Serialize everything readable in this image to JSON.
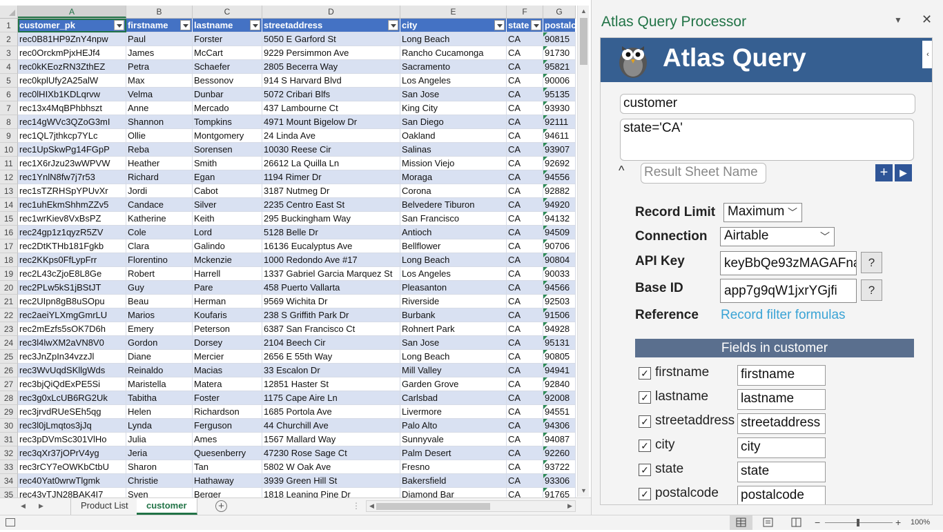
{
  "grid": {
    "columns": [
      {
        "letter": "A",
        "w": 157
      },
      {
        "letter": "B",
        "w": 96
      },
      {
        "letter": "C",
        "w": 101
      },
      {
        "letter": "D",
        "w": 200
      },
      {
        "letter": "E",
        "w": 154
      },
      {
        "letter": "F",
        "w": 53
      },
      {
        "letter": "G",
        "w": 47
      }
    ],
    "headers": [
      "customer_pk",
      "firstname",
      "lastname",
      "streetaddress",
      "city",
      "state",
      "postalco"
    ],
    "rows": [
      [
        "rec0B81HP9ZnY4npw",
        "Paul",
        "Forster",
        "5050 E Garford St",
        "Long Beach",
        "CA",
        "90815"
      ],
      [
        "rec0OrckmPjxHEJf4",
        "James",
        "McCart",
        "9229 Persimmon Ave",
        "Rancho Cucamonga",
        "CA",
        "91730"
      ],
      [
        "rec0kKEozRN3ZthEZ",
        "Petra",
        "Schaefer",
        "2805 Becerra Way",
        "Sacramento",
        "CA",
        "95821"
      ],
      [
        "rec0kplUfy2A25alW",
        "Max",
        "Bessonov",
        "914 S Harvard Blvd",
        "Los Angeles",
        "CA",
        "90006"
      ],
      [
        "rec0lHIXb1KDLqrvw",
        "Velma",
        "Dunbar",
        "5072 Cribari Blfs",
        "San Jose",
        "CA",
        "95135"
      ],
      [
        "rec13x4MqBPhbhszt",
        "Anne",
        "Mercado",
        "437 Lambourne Ct",
        "King City",
        "CA",
        "93930"
      ],
      [
        "rec14gWVc3QZoG3mI",
        "Shannon",
        "Tompkins",
        "4971 Mount Bigelow Dr",
        "San Diego",
        "CA",
        "92111"
      ],
      [
        "rec1QL7jthkcp7YLc",
        "Ollie",
        "Montgomery",
        "24 Linda Ave",
        "Oakland",
        "CA",
        "94611"
      ],
      [
        "rec1UpSkwPg14FGpP",
        "Reba",
        "Sorensen",
        "10030 Reese Cir",
        "Salinas",
        "CA",
        "93907"
      ],
      [
        "rec1X6rJzu23wWPVW",
        "Heather",
        "Smith",
        "26612 La Quilla Ln",
        "Mission Viejo",
        "CA",
        "92692"
      ],
      [
        "rec1YnlN8fw7j7r53",
        "Richard",
        "Egan",
        "1194 Rimer Dr",
        "Moraga",
        "CA",
        "94556"
      ],
      [
        "rec1sTZRHSpYPUvXr",
        "Jordi",
        "Cabot",
        "3187 Nutmeg Dr",
        "Corona",
        "CA",
        "92882"
      ],
      [
        "rec1uhEkmShhmZZv5",
        "Candace",
        "Silver",
        "2235 Centro East St",
        "Belvedere Tiburon",
        "CA",
        "94920"
      ],
      [
        "rec1wrKiev8VxBsPZ",
        "Katherine",
        "Keith",
        "295 Buckingham Way",
        "San Francisco",
        "CA",
        "94132"
      ],
      [
        "rec24gp1z1qyzR5ZV",
        "Cole",
        "Lord",
        "5128 Belle Dr",
        "Antioch",
        "CA",
        "94509"
      ],
      [
        "rec2DtKTHb181Fgkb",
        "Clara",
        "Galindo",
        "16136 Eucalyptus Ave",
        "Bellflower",
        "CA",
        "90706"
      ],
      [
        "rec2KKps0FfLypFrr",
        "Florentino",
        "Mckenzie",
        "1000 Redondo Ave #17",
        "Long Beach",
        "CA",
        "90804"
      ],
      [
        "rec2L43cZjoE8L8Ge",
        "Robert",
        "Harrell",
        "1337 Gabriel Garcia Marquez St",
        "Los Angeles",
        "CA",
        "90033"
      ],
      [
        "rec2PLw5kS1jBStJT",
        "Guy",
        "Pare",
        "458 Puerto Vallarta",
        "Pleasanton",
        "CA",
        "94566"
      ],
      [
        "rec2UIpn8gB8uSOpu",
        "Beau",
        "Herman",
        "9569 Wichita Dr",
        "Riverside",
        "CA",
        "92503"
      ],
      [
        "rec2aeiYLXmgGmrLU",
        "Marios",
        "Koufaris",
        "238 S Griffith Park Dr",
        "Burbank",
        "CA",
        "91506"
      ],
      [
        "rec2mEzfs5sOK7D6h",
        "Emery",
        "Peterson",
        "6387 San Francisco Ct",
        "Rohnert Park",
        "CA",
        "94928"
      ],
      [
        "rec3l4lwXM2aVN8V0",
        "Gordon",
        "Dorsey",
        "2104 Beech Cir",
        "San Jose",
        "CA",
        "95131"
      ],
      [
        "rec3JnZpIn34vzzJl",
        "Diane",
        "Mercier",
        "2656 E 55th Way",
        "Long Beach",
        "CA",
        "90805"
      ],
      [
        "rec3WvUqdSKllgWds",
        "Reinaldo",
        "Macias",
        "33 Escalon Dr",
        "Mill Valley",
        "CA",
        "94941"
      ],
      [
        "rec3bjQiQdExPE5Si",
        "Maristella",
        "Matera",
        "12851 Haster St",
        "Garden Grove",
        "CA",
        "92840"
      ],
      [
        "rec3g0xLcUB6RG2Uk",
        "Tabitha",
        "Foster",
        "1175 Cape Aire Ln",
        "Carlsbad",
        "CA",
        "92008"
      ],
      [
        "rec3jrvdRUeSEh5qg",
        "Helen",
        "Richardson",
        "1685 Portola Ave",
        "Livermore",
        "CA",
        "94551"
      ],
      [
        "rec3l0jLmqtos3jJq",
        "Lynda",
        "Ferguson",
        "44 Churchill Ave",
        "Palo Alto",
        "CA",
        "94306"
      ],
      [
        "rec3pDVmSc301VlHo",
        "Julia",
        "Ames",
        "1567 Mallard Way",
        "Sunnyvale",
        "CA",
        "94087"
      ],
      [
        "rec3qXr37jOPrV4yg",
        "Jeria",
        "Quesenberry",
        "47230 Rose Sage Ct",
        "Palm Desert",
        "CA",
        "92260"
      ],
      [
        "rec3rCY7eOWKbCtbU",
        "Sharon",
        "Tan",
        "5802 W Oak Ave",
        "Fresno",
        "CA",
        "93722"
      ],
      [
        "rec40Yat0wrwTlgmk",
        "Christie",
        "Hathaway",
        "3939 Green Hill St",
        "Bakersfield",
        "CA",
        "93306"
      ],
      [
        "rec43yTJN28BAK4I7",
        "Sven",
        "Berger",
        "1818 Leaning Pine Dr",
        "Diamond Bar",
        "CA",
        "91765"
      ]
    ]
  },
  "tabs": {
    "items": [
      "Product List",
      "customer"
    ],
    "active": 1
  },
  "status": {
    "zoom": "100%"
  },
  "pane": {
    "title": "Atlas Query Processor",
    "banner_title": "Atlas Query",
    "table_input": "customer",
    "filter_input": "state='CA'",
    "result_placeholder": "Result Sheet Name",
    "record_limit_label": "Record Limit",
    "record_limit_value": "Maximum",
    "connection_label": "Connection",
    "connection_value": "Airtable",
    "api_key_label": "API Key",
    "api_key_value": "keyBbQe93zMAGAFna",
    "base_id_label": "Base ID",
    "base_id_value": "app7g9qW1jxrYGjfi",
    "reference_label": "Reference",
    "reference_link": "Record filter formulas",
    "fields_header": "Fields in customer",
    "help_label": "?",
    "fields": [
      {
        "name": "firstname",
        "alias": "firstname",
        "checked": true
      },
      {
        "name": "lastname",
        "alias": "lastname",
        "checked": true
      },
      {
        "name": "streetaddress",
        "alias": "streetaddress",
        "checked": true
      },
      {
        "name": "city",
        "alias": "city",
        "checked": true
      },
      {
        "name": "state",
        "alias": "state",
        "checked": true
      },
      {
        "name": "postalcode",
        "alias": "postalcode",
        "checked": true
      }
    ]
  }
}
